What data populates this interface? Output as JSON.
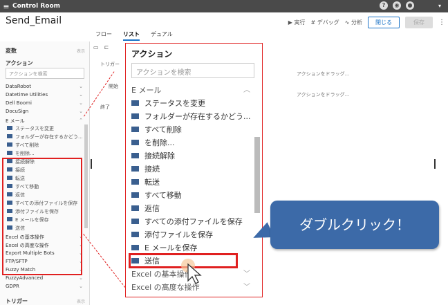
{
  "app": {
    "title": "Control Room",
    "menu_icon": "hamburger-icon"
  },
  "page": {
    "title": "Send_Email"
  },
  "tabs": [
    {
      "label": "フロー",
      "active": false
    },
    {
      "label": "リスト",
      "active": true
    },
    {
      "label": "デュアル",
      "active": false
    }
  ],
  "toolbar": {
    "run_label": "▶ 実行",
    "debug_label": "# デバッグ",
    "analyze_label": "∿ 分析",
    "close_label": "閉じる",
    "save_label": "保存"
  },
  "sidebar": {
    "variables_label": "変数",
    "variables_toggle": "表示",
    "actions_label": "アクション",
    "search_placeholder": "アクションを検索",
    "categories_top": [
      "DataRobot",
      "Datetime Utilities",
      "Dell Boomi",
      "DocuSign"
    ],
    "email_category": "E メール",
    "email_items": [
      "ステータスを変更",
      "フォルダーが存在するかどう...",
      "すべて削除",
      "を削除...",
      "接続解除",
      "接続",
      "転送",
      "すべて移動",
      "返信",
      "すべての添付ファイルを保存",
      "添付ファイルを保存",
      "E メールを保存",
      "送信"
    ],
    "categories_bottom": [
      "Excel の基本操作",
      "Excel の高度な操作",
      "Export Multiple Bots",
      "FTP/SFTP",
      "Fuzzy Match",
      "FuzzyAdvanced",
      "GDPR"
    ],
    "trigger_label": "トリガー",
    "trigger_toggle": "表示"
  },
  "canvas": {
    "trigger_label": "トリガー",
    "start_label": "開始",
    "end_label": "終了",
    "drag_hint_1": "アクションをドラッグ...",
    "drag_hint_2": "アクションをドラッグ..."
  },
  "popup": {
    "title": "アクション",
    "search_placeholder": "アクションを検索",
    "category": "E メール",
    "items": [
      "ステータスを変更",
      "フォルダーが存在するかどう...",
      "すべて削除",
      "を削除...",
      "接続解除",
      "接続",
      "転送",
      "すべて移動",
      "返信",
      "すべての添付ファイルを保存",
      "添付ファイルを保存",
      "E メールを保存",
      "送信"
    ],
    "categories_after": [
      "Excel の基本操作",
      "Excel の高度な操作"
    ]
  },
  "callout": {
    "text": "ダブルクリック！"
  },
  "colors": {
    "highlight": "#e02020",
    "accent": "#1a73c7",
    "callout": "#3c6aa8",
    "envelope": "#3a5f8f"
  }
}
